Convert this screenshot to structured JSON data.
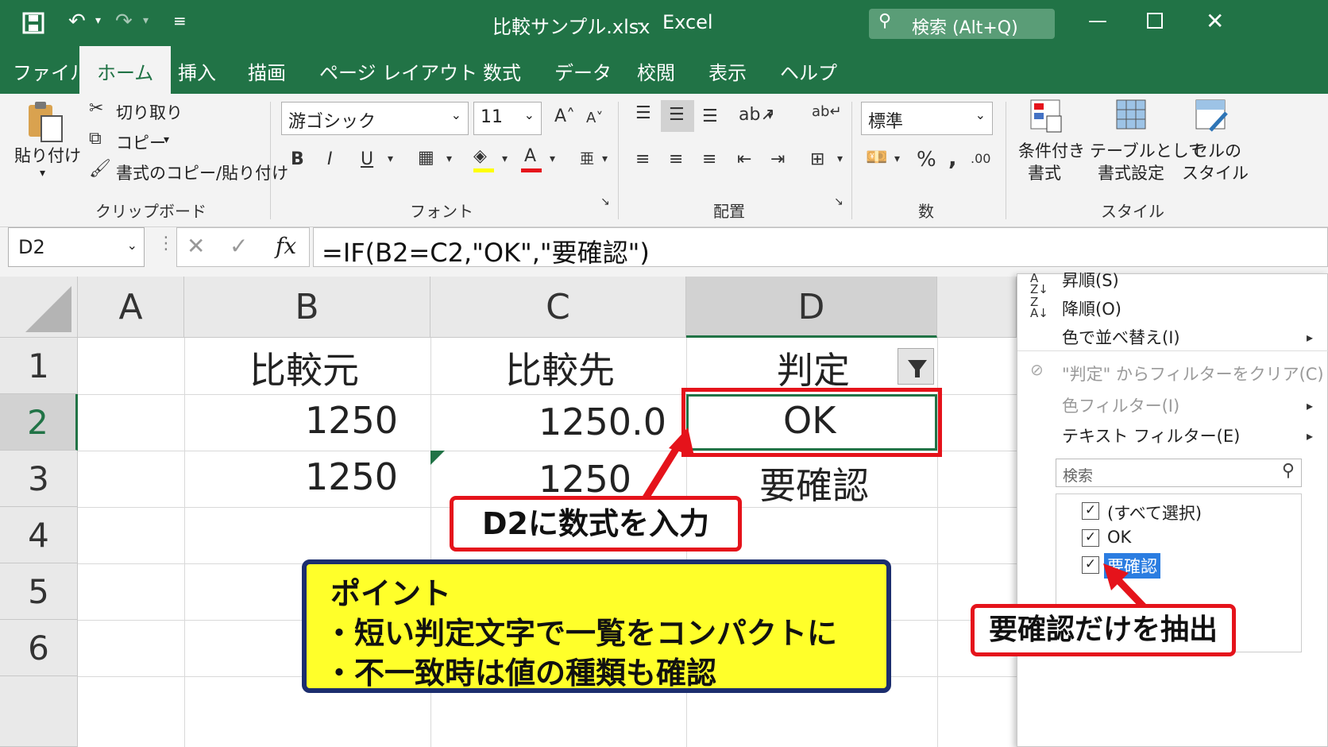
{
  "window": {
    "title": "比較サンプル.xlsx",
    "sep": "-",
    "app": "Excel",
    "search_label": "検索 (Alt+Q)"
  },
  "tabs": [
    "ファイル",
    "ホーム",
    "挿入",
    "描画",
    "ページ レイアウト",
    "数式",
    "データ",
    "校閲",
    "表示",
    "ヘルプ"
  ],
  "ribbon": {
    "paste": "貼り付け",
    "cut": "切り取り",
    "copy": "コピー",
    "format_painter": "書式のコピー/貼り付け",
    "clipboard_group": "クリップボード",
    "font_name": "游ゴシック",
    "font_size": "11",
    "bold": "B",
    "italic": "I",
    "underline": "U",
    "font_group": "フォント",
    "align_group": "配置",
    "number_format": "標準",
    "number_group": "数",
    "cond_format": [
      "条件付き",
      "書式"
    ],
    "table_format": [
      "テーブルとして",
      "書式設定"
    ],
    "cell_style": [
      "セルの",
      "スタイル"
    ],
    "style_group": "スタイル"
  },
  "formula_bar": {
    "name_box": "D2",
    "fx": "fx",
    "formula": "=IF(B2=C2,\"OK\",\"要確認\")"
  },
  "sheet": {
    "columns": [
      "A",
      "B",
      "C",
      "D"
    ],
    "rows": [
      "1",
      "2",
      "3",
      "4",
      "5",
      "6"
    ],
    "B1": "比較元",
    "C1": "比較先",
    "D1": "判定",
    "B2": "1250",
    "C2": "1250.0",
    "D2": "OK",
    "B3": "1250",
    "C3": "1250",
    "D3": "要確認"
  },
  "filter_menu": {
    "sort_asc": "昇順(S)",
    "sort_desc": "降順(O)",
    "sort_color": "色で並べ替え(I)",
    "clear_filter": "\"判定\" からフィルターをクリア(C)",
    "color_filter": "色フィルター(I)",
    "text_filter": "テキスト フィルター(E)",
    "search_placeholder": "検索",
    "items": [
      "(すべて選択)",
      "OK",
      "要確認"
    ]
  },
  "callouts": {
    "formula_note": "D2に数式を入力",
    "extract_note": "要確認だけを抽出",
    "point_title": "ポイント",
    "point_1": "・短い判定文字で一覧をコンパクトに",
    "point_2": "・不一致時は値の種類も確認"
  },
  "colors": {
    "excel_green": "#217346",
    "highlight_red": "#e5131b",
    "note_yellow": "#ffff2a",
    "note_border": "#1c2e6e"
  }
}
